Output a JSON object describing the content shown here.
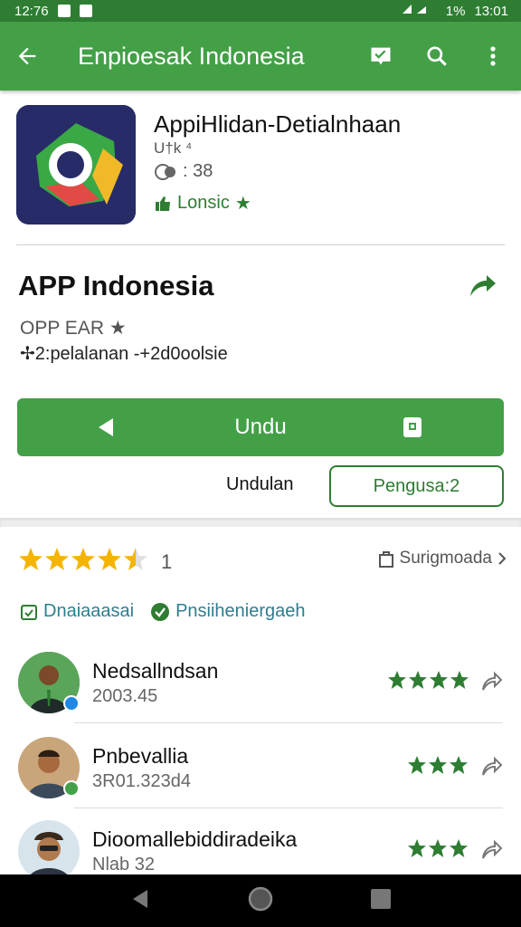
{
  "status_bar": {
    "time": "12:76",
    "right_text": "1%",
    "right_time": "13:01"
  },
  "app_bar": {
    "title": "Enpioesak Indonesia"
  },
  "app_header": {
    "name": "AppiHlidan-Detialnhaan",
    "sub": "U†k ⁴",
    "rating_text": ": 38",
    "license": "Lonsic"
  },
  "details": {
    "title": "APP Indonesia",
    "meta1": "OPP EAR ★",
    "meta2": "✢2:pelalanan -+2d0oolsie"
  },
  "actions": {
    "install_label": "Undu",
    "download_label": "Undulan",
    "update_label": "Pengusa:2"
  },
  "rating": {
    "value": 4.5,
    "count": "1",
    "summary": "Surigmoada"
  },
  "tags": [
    {
      "label": "Dnaiaaasai"
    },
    {
      "label": "Pnsiiheniergaeh"
    }
  ],
  "reviews": [
    {
      "name": "Nedsallndsan",
      "date": "2003.45",
      "stars": 4
    },
    {
      "name": "Pnbevallia",
      "date": "3R01.323d4",
      "stars": 3
    },
    {
      "name": "Dioomallebiddiradeika",
      "date": "Nlab 32",
      "stars": 3
    }
  ],
  "colors": {
    "primary": "#43a047",
    "primary_dark": "#2e7d32",
    "star_gold": "#f4b400",
    "tag_teal": "#2e7d8f"
  }
}
